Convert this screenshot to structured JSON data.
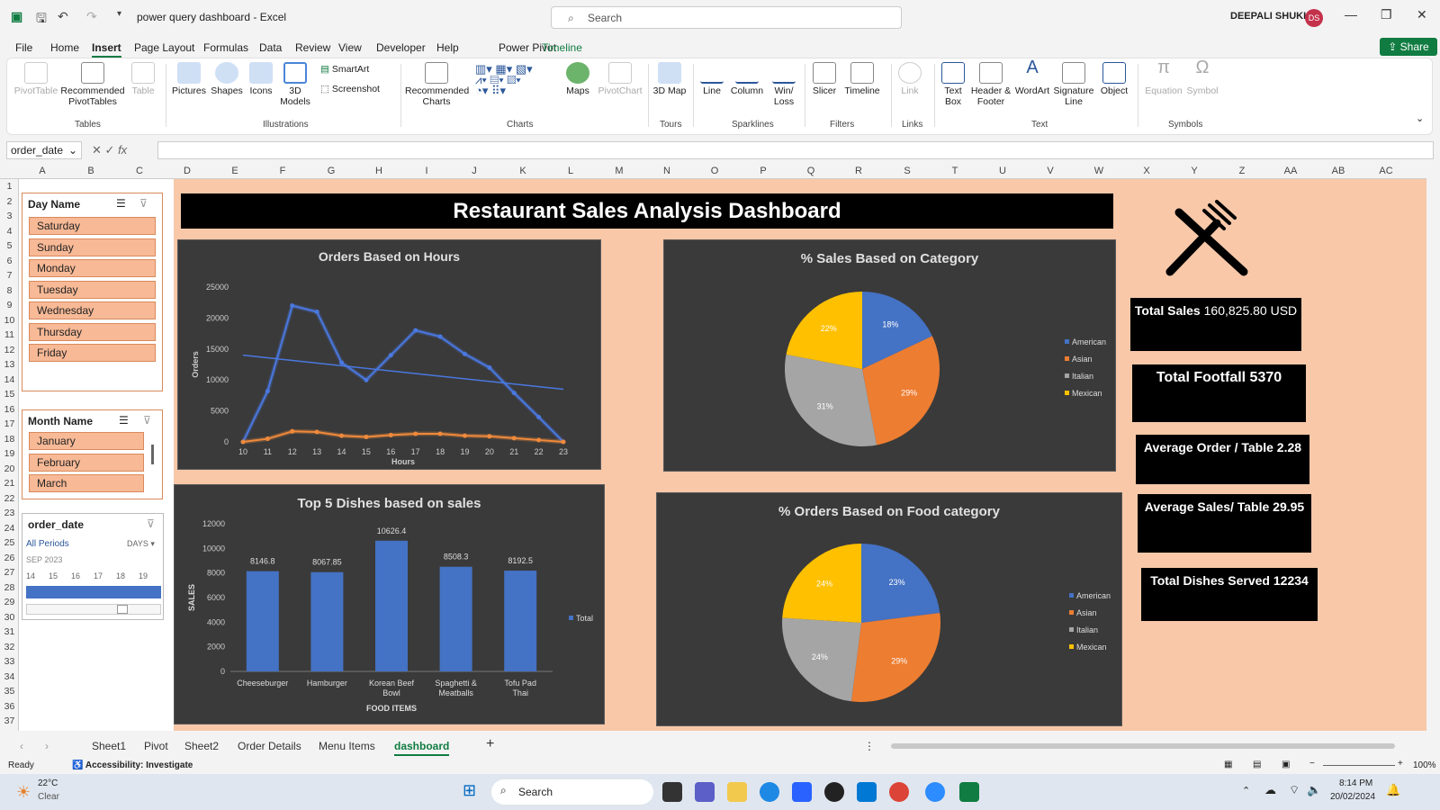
{
  "titlebar": {
    "doc_title": "power query dashboard  -  Excel",
    "search_placeholder": "Search",
    "user_name": "DEEPALI SHUKLA",
    "user_initials": "DS"
  },
  "menu": [
    "File",
    "Home",
    "Insert",
    "Page Layout",
    "Formulas",
    "Data",
    "Review",
    "View",
    "Developer",
    "Help",
    "Power Pivot",
    "Timeline"
  ],
  "menu_active": "Insert",
  "share_label": "Share",
  "ribbon": {
    "tables": {
      "pivottable": "PivotTable",
      "recommended": "Recommended PivotTables",
      "table": "Table",
      "group": "Tables"
    },
    "illustrations": {
      "pictures": "Pictures",
      "shapes": "Shapes",
      "icons": "Icons",
      "models": "3D Models",
      "smartart": "SmartArt",
      "screenshot": "Screenshot",
      "group": "Illustrations"
    },
    "charts": {
      "recommended": "Recommended Charts",
      "maps": "Maps",
      "pivotchart": "PivotChart",
      "group": "Charts"
    },
    "tours": {
      "map3d": "3D Map",
      "group": "Tours"
    },
    "sparklines": {
      "line": "Line",
      "column": "Column",
      "winloss": "Win/ Loss",
      "group": "Sparklines"
    },
    "filters": {
      "slicer": "Slicer",
      "timeline": "Timeline",
      "group": "Filters"
    },
    "links": {
      "link": "Link",
      "group": "Links"
    },
    "text": {
      "textbox": "Text Box",
      "header": "Header & Footer",
      "wordart": "WordArt",
      "signature": "Signature Line",
      "object": "Object",
      "group": "Text"
    },
    "symbols": {
      "equation": "Equation",
      "symbol": "Symbol",
      "group": "Symbols"
    }
  },
  "formula": {
    "namebox": "order_date",
    "fx": "fx"
  },
  "columns": [
    "A",
    "B",
    "C",
    "D",
    "E",
    "F",
    "G",
    "H",
    "I",
    "J",
    "K",
    "L",
    "M",
    "N",
    "O",
    "P",
    "Q",
    "R",
    "S",
    "T",
    "U",
    "V",
    "W",
    "X",
    "Y",
    "Z",
    "AA",
    "AB",
    "AC"
  ],
  "rows": [
    "1",
    "2",
    "3",
    "4",
    "5",
    "6",
    "7",
    "8",
    "9",
    "10",
    "11",
    "12",
    "13",
    "14",
    "15",
    "16",
    "17",
    "18",
    "19",
    "20",
    "21",
    "22",
    "23",
    "24",
    "25",
    "26",
    "27",
    "28",
    "29",
    "30",
    "31",
    "32",
    "33",
    "34",
    "35",
    "36",
    "37"
  ],
  "slicer_day": {
    "title": "Day Name",
    "items": [
      "Saturday",
      "Sunday",
      "Monday",
      "Tuesday",
      "Wednesday",
      "Thursday",
      "Friday"
    ]
  },
  "slicer_month": {
    "title": "Month Name",
    "items": [
      "January",
      "February",
      "March"
    ]
  },
  "timeline": {
    "title": "order_date",
    "period": "All Periods",
    "unit": "DAYS",
    "month": "SEP 2023",
    "days": [
      "14",
      "15",
      "16",
      "17",
      "18",
      "19"
    ]
  },
  "dashboard": {
    "title": "Restaurant Sales Analysis Dashboard"
  },
  "kpis": [
    {
      "label": "Total Sales",
      "value": "160,825.80 USD"
    },
    {
      "label": "Total Footfall 5370",
      "value": ""
    },
    {
      "label": "Average Order / Table 2.28",
      "value": ""
    },
    {
      "label": "Average Sales/ Table 29.95",
      "value": ""
    },
    {
      "label": "Total Dishes Served 12234",
      "value": ""
    }
  ],
  "chart_data": [
    {
      "type": "line",
      "title": "Orders Based on Hours",
      "xlabel": "Hours",
      "ylabel": "Orders",
      "x": [
        10,
        11,
        12,
        13,
        14,
        15,
        16,
        17,
        18,
        19,
        20,
        21,
        22,
        23
      ],
      "ylim": [
        0,
        25000
      ],
      "yticks": [
        0,
        5000,
        10000,
        15000,
        20000,
        25000
      ],
      "series": [
        {
          "values": [
            0,
            8200,
            22000,
            21000,
            12800,
            10000,
            14000,
            18000,
            17000,
            14200,
            12000,
            7900,
            4000,
            0
          ],
          "color": "#4a78e0"
        },
        {
          "values": [
            0,
            500,
            1700,
            1600,
            1000,
            800,
            1100,
            1300,
            1300,
            1000,
            900,
            600,
            300,
            0
          ],
          "color": "#f08a3c"
        }
      ],
      "trendline": [
        14000,
        8500
      ]
    },
    {
      "type": "pie",
      "title": "% Sales Based on Category",
      "legend": [
        "American",
        "Asian",
        "Italian",
        "Mexican"
      ],
      "values": [
        18,
        29,
        31,
        22
      ],
      "labels": [
        "18%",
        "29%",
        "31%",
        "22%"
      ],
      "colors": [
        "#4472c4",
        "#ed7d31",
        "#a5a5a5",
        "#ffc000"
      ]
    },
    {
      "type": "bar",
      "title": "Top 5 Dishes based on sales",
      "xlabel": "FOOD ITEMS",
      "ylabel": "SALES",
      "categories": [
        "Cheeseburger",
        "Hamburger",
        "Korean Beef Bowl",
        "Spaghetti & Meatballs",
        "Tofu Pad Thai"
      ],
      "values": [
        8146.8,
        8067.85,
        10626.4,
        8508.3,
        8192.5
      ],
      "labels": [
        "8146.8",
        "8067.85",
        "10626.4",
        "8508.3",
        "8192.5"
      ],
      "ylim": [
        0,
        12000
      ],
      "yticks": [
        0,
        2000,
        4000,
        6000,
        8000,
        10000,
        12000
      ],
      "series_name": "Total",
      "color": "#4472c4"
    },
    {
      "type": "pie",
      "title": "% Orders Based on Food category",
      "legend": [
        "American",
        "Asian",
        "Italian",
        "Mexican"
      ],
      "values": [
        23,
        29,
        24,
        24
      ],
      "labels": [
        "23%",
        "29%",
        "24%",
        "24%"
      ],
      "colors": [
        "#4472c4",
        "#ed7d31",
        "#a5a5a5",
        "#ffc000"
      ]
    }
  ],
  "sheet_tabs": [
    "Sheet1",
    "Pivot",
    "Sheet2",
    "Order Details",
    "Menu Items",
    "dashboard"
  ],
  "sheet_tab_active": "dashboard",
  "status": {
    "ready": "Ready",
    "accessibility": "Accessibility: Investigate",
    "zoom": "100%"
  },
  "taskbar": {
    "weather": "22°C",
    "weather_desc": "Clear",
    "search": "Search",
    "time": "8:14 PM",
    "date": "20/02/2024"
  }
}
